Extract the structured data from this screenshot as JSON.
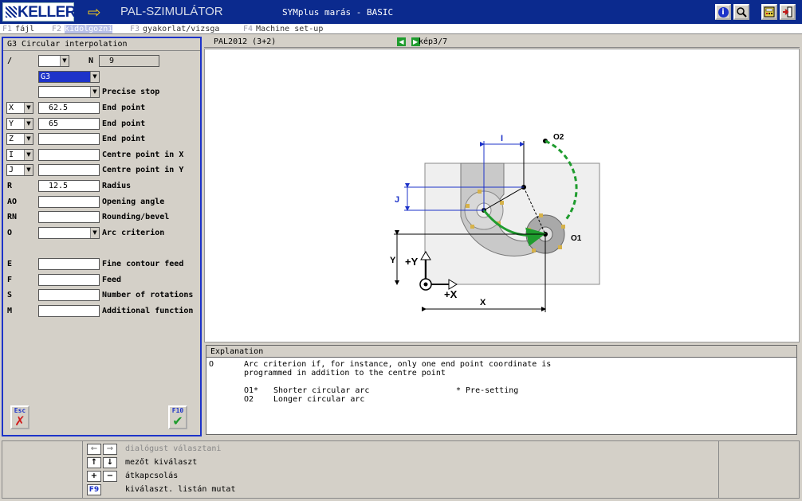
{
  "header": {
    "logo_text": "KELLER",
    "app_name": "PAL-SZIMULÁTOR",
    "document": "SYMplus marás - BASIC",
    "buttons": [
      {
        "name": "info-button",
        "icon": "info-icon",
        "glyph": "i"
      },
      {
        "name": "search-button",
        "icon": "magnifier-icon",
        "glyph": "⌕"
      },
      {
        "name": "calculator-button",
        "icon": "calculator-icon",
        "glyph": "▦"
      },
      {
        "name": "exit-button",
        "icon": "exit-door-icon",
        "glyph": "➜"
      }
    ]
  },
  "menu": [
    {
      "key": "F1",
      "label": "fájl"
    },
    {
      "key": "F2",
      "label": "kidolgozni"
    },
    {
      "key": "F3",
      "label": "gyakorlat/vizsga"
    },
    {
      "key": "F4",
      "label": "Machine set-up"
    }
  ],
  "dialog": {
    "title": "G3 Circular interpolation",
    "slash": "/",
    "n_label": "N",
    "n_value": "9",
    "g_code": "G3",
    "precise_stop": "Precise stop",
    "fields": [
      {
        "code": "X",
        "value": "62.5",
        "label": "End point"
      },
      {
        "code": "Y",
        "value": "65",
        "label": "End point"
      },
      {
        "code": "Z",
        "value": "",
        "label": "End point"
      },
      {
        "code": "I",
        "value": "",
        "label": "Centre point in X"
      },
      {
        "code": "J",
        "value": "",
        "label": "Centre point in Y"
      },
      {
        "code": "R",
        "value": "12.5",
        "label": "Radius"
      },
      {
        "code": "AO",
        "value": "",
        "label": "Opening angle"
      },
      {
        "code": "RN",
        "value": "",
        "label": "Rounding/bevel"
      },
      {
        "code": "O",
        "value": "",
        "label": "Arc criterion"
      },
      {
        "code": "E",
        "value": "",
        "label": "Fine contour feed"
      },
      {
        "code": "F",
        "value": "",
        "label": "Feed"
      },
      {
        "code": "S",
        "value": "",
        "label": "Number of rotations"
      },
      {
        "code": "M",
        "value": "",
        "label": "Additional function"
      }
    ],
    "esc_key": "Esc",
    "f10_key": "F10"
  },
  "viewer": {
    "program": "PAL2012 (3+2)",
    "counter": "kép3/7",
    "drawing_labels": {
      "o1": "O1",
      "o2": "O2",
      "i": "I",
      "j": "J",
      "x": "X",
      "y": "Y",
      "plus_x": "+X",
      "plus_y": "+Y"
    }
  },
  "explanation": {
    "title": "Explanation",
    "code": "O",
    "line1": "Arc criterion if, for instance, only one end point coordinate is",
    "line2": "programmed in addition to the centre point",
    "opt1_code": "O1*",
    "opt1_text": "Shorter circular arc",
    "opt2_code": "O2",
    "opt2_text": "Longer circular arc",
    "presetting": "* Pre-setting"
  },
  "status": {
    "rows": [
      {
        "keys": [
          "←",
          "→"
        ],
        "text": "dialógust választani",
        "disabled": true
      },
      {
        "keys": [
          "↑",
          "↓"
        ],
        "text": "mezőt kiválaszt",
        "disabled": false
      },
      {
        "keys": [
          "+",
          "−"
        ],
        "text": "átkapcsolás",
        "disabled": false
      },
      {
        "keys": [
          "F9"
        ],
        "text": "kiválaszt. listán mutat",
        "disabled": false
      }
    ]
  },
  "colors": {
    "title_bar": "#0b2a8e",
    "dialog_border": "#1d33c9",
    "arc_green": "#1f9c2e",
    "dimension_blue": "#1d33c9"
  }
}
